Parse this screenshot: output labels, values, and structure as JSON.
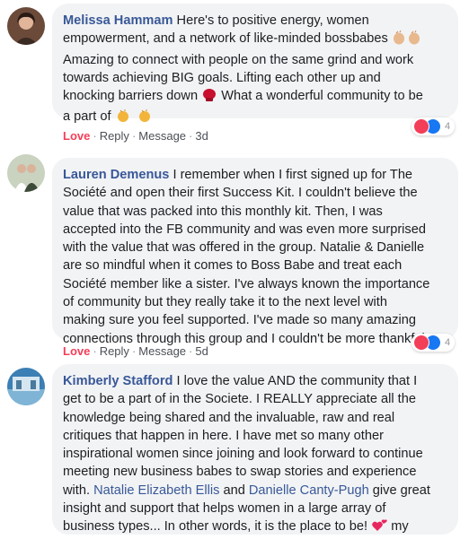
{
  "colors": {
    "author": "#385898",
    "love": "#f33e58",
    "like": "#1877f2",
    "bubble": "#f2f3f5"
  },
  "comments": [
    {
      "author": "Melissa Hammam",
      "line1": " Here's to positive energy, women",
      "line2": "empowerment, and a network of like-minded bossbabes",
      "line3": "Amazing to connect with people on the same grind and work",
      "line4": "towards achieving BIG goals. Lifting each other up and",
      "line5": "knocking barriers down",
      "line5b": " What a wonderful community to be",
      "line6": "a part of",
      "love": "Love",
      "reply": "Reply",
      "message": "Message",
      "time": "3d",
      "reaction_count": "4"
    },
    {
      "author": "Lauren Demenus",
      "line1": " I remember when I first signed up for The",
      "line2": "Société and open their first Success Kit. I couldn't believe the",
      "line3": "value that was packed into this monthly kit. Then, I was",
      "line4": "accepted into the FB community and was even more surprised",
      "line5": "with the value that was offered in the group. Natalie & Danielle",
      "line6": "are so mindful when it comes to Boss Babe and treat each",
      "line7": "Société member like a sister. I've always known the importance",
      "line8": "of community but they really take it to the next level with",
      "line9": "making sure you feel supported. I've made so many amazing",
      "line10": "connections through this group and I couldn't be more thankful.",
      "love": "Love",
      "reply": "Reply",
      "message": "Message",
      "time": "5d",
      "reaction_count": "4"
    },
    {
      "author": "Kimberly Stafford",
      "line1": " I love the value AND the community that I",
      "line2": "get to be a part of in the Societe. I REALLY appreciate all the",
      "line3": "knowledge being shared and the invaluable, raw and real",
      "line4": "critiques that happen in here. I have met so many other",
      "line5": "inspirational women since joining and look forward to continue",
      "line6": "meeting new business babes to swap stories and experience",
      "line7a": "with. ",
      "mention1": "Natalie Elizabeth Ellis",
      "line7b": " and ",
      "mention2": "Danielle Canty-Pugh",
      "line7c": " give great",
      "line8": "insight and support that helps women in a large array of",
      "line9": "business types... In other words, it is the place to be!",
      "line9b": " my"
    }
  ]
}
